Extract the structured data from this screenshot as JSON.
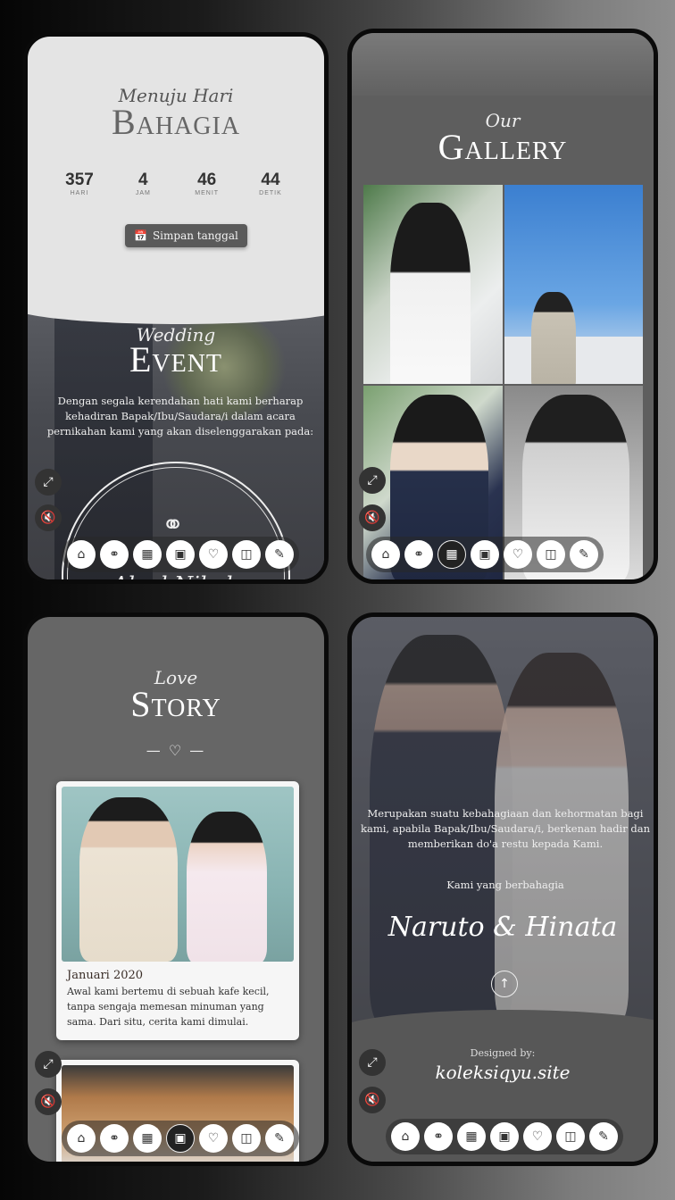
{
  "countdown_screen": {
    "subtitle": "Menuju Hari",
    "title": "Bahagia",
    "countdown": [
      {
        "value": "357",
        "label": "HARI"
      },
      {
        "value": "4",
        "label": "JAM"
      },
      {
        "value": "46",
        "label": "MENIT"
      },
      {
        "value": "44",
        "label": "DETIK"
      }
    ],
    "save_button": "Simpan tanggal",
    "event_subtitle": "Wedding",
    "event_title": "Event",
    "intro_text": "Dengan segala kerendahan hati kami berharap kehadiran Bapak/Ibu/Saudara/i dalam acara pernikahan kami yang akan diselenggarakan pada:",
    "akad_title": "Akad Nikah"
  },
  "gallery_screen": {
    "subtitle": "Our",
    "title": "Gallery"
  },
  "story_screen": {
    "subtitle": "Love",
    "title": "Story",
    "divider": "— ♡ —",
    "cards": [
      {
        "date": "Januari 2020",
        "text": "Awal kami bertemu di sebuah kafe kecil, tanpa sengaja memesan minuman yang sama. Dari situ, cerita kami dimulai."
      }
    ]
  },
  "closing_screen": {
    "message": "Merupakan suatu kebahagiaan dan kehormatan bagi kami, apabila Bapak/Ibu/Saudara/i, berkenan hadir dan memberikan do'a restu kepada Kami.",
    "signoff": "Kami yang berbahagia",
    "names": "Naruto & Hinata",
    "designed_by_label": "Designed by:",
    "designer_site": "koleksiqyu.site"
  },
  "icons": {
    "side": [
      "fullscreen-exit-icon",
      "mute-icon"
    ],
    "nav": [
      "home-icon",
      "rings-icon",
      "calendar-icon",
      "gallery-icon",
      "heart-icon",
      "gift-icon",
      "edit-icon"
    ]
  }
}
